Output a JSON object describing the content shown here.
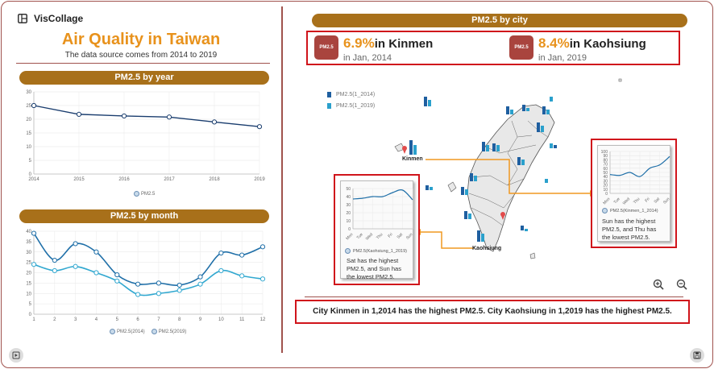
{
  "brand": {
    "name": "VisCollage"
  },
  "header": {
    "title": "Air Quality in Taiwan",
    "subtitle": "The data source comes from 2014 to 2019"
  },
  "year_panel": {
    "title": "PM2.5 by year"
  },
  "month_panel": {
    "title": "PM2.5 by month"
  },
  "city_panel": {
    "title": "PM2.5 by city"
  },
  "stats": [
    {
      "value": "6.9%",
      "text": "in Kinmen",
      "sub": "in Jan, 2014",
      "badge": "PM2.5"
    },
    {
      "value": "8.4%",
      "text": "in Kaohsiung",
      "sub": "in Jan, 2019",
      "badge": "PM2.5"
    }
  ],
  "map": {
    "legend": [
      "PM2.5(1_2014)",
      "PM2.5(1_2019)"
    ],
    "cities": {
      "kinmen": "Kinmen",
      "kaohsiung": "Kaohsiung"
    }
  },
  "popups": {
    "kaohsiung": {
      "legend": "PM2.5(Kaohsiung_1_2019)",
      "desc_lines": [
        "Sat has the highest",
        "PM2.5, and Sun has",
        "the lowest PM2.5."
      ]
    },
    "kinmen": {
      "legend": "PM2.5(Kinmen_1_2014)",
      "desc_lines": [
        "Sun has the highest",
        "PM2.5, and Thu has",
        "the lowest PM2.5."
      ]
    }
  },
  "summary": "City Kinmen in 1,2014 has the highest PM2.5. City Kaohsiung in 1,2019 has the highest PM2.5.",
  "colors": {
    "accent": "#e8921c",
    "pill": "#a8701a",
    "frame": "#a0524d",
    "highlight": "#d0141b",
    "series_dark": "#1f6fa8",
    "series_light": "#32a8d0",
    "year_line": "#1a3d6e"
  },
  "icons": {
    "brand": "layout-icon",
    "play": "play-icon",
    "save": "save-icon",
    "zoom_in": "zoom-in-icon",
    "zoom_out": "zoom-out-icon",
    "badge": "pm25-badge-icon"
  },
  "chart_data": [
    {
      "type": "line",
      "name": "year",
      "categories": [
        "2014",
        "2015",
        "2016",
        "2017",
        "2018",
        "2019"
      ],
      "series": [
        {
          "name": "PM2.5",
          "values": [
            25,
            21.8,
            21.2,
            20.8,
            19,
            17.3
          ]
        }
      ],
      "ylim": [
        0,
        30
      ],
      "yticks": [
        0,
        5,
        10,
        15,
        20,
        25,
        30
      ],
      "grid": true,
      "legend": "bottom"
    },
    {
      "type": "line",
      "name": "month",
      "categories": [
        "1",
        "2",
        "3",
        "4",
        "5",
        "6",
        "7",
        "8",
        "9",
        "10",
        "11",
        "12"
      ],
      "series": [
        {
          "name": "PM2.5(2014)",
          "values": [
            39,
            26,
            34,
            30,
            19,
            14.5,
            15,
            14,
            18,
            29.5,
            28.5,
            32.5
          ]
        },
        {
          "name": "PM2.5(2019)",
          "values": [
            24,
            21,
            23,
            20,
            16,
            9.5,
            10,
            11.5,
            14.5,
            21,
            18.5,
            17
          ]
        }
      ],
      "ylim": [
        0,
        40
      ],
      "yticks": [
        0,
        5,
        10,
        15,
        20,
        25,
        30,
        35,
        40
      ],
      "grid": true,
      "legend": "bottom"
    },
    {
      "type": "line",
      "name": "kaohsiung_week",
      "categories": [
        "Mon",
        "Tue",
        "Wed",
        "Thu",
        "Fri",
        "Sat",
        "Sun"
      ],
      "series": [
        {
          "name": "PM2.5(Kaohsiung_1_2019)",
          "values": [
            37,
            38,
            40,
            40,
            45,
            48,
            36
          ]
        }
      ],
      "ylim": [
        0,
        50
      ],
      "yticks": [
        0,
        10,
        20,
        30,
        40,
        50
      ],
      "grid": true,
      "legend": "bottom"
    },
    {
      "type": "line",
      "name": "kinmen_week",
      "categories": [
        "Mon",
        "Tue",
        "Wed",
        "Thu",
        "Fri",
        "Sat",
        "Sun"
      ],
      "series": [
        {
          "name": "PM2.5(Kinmen_1_2014)",
          "values": [
            45,
            43,
            50,
            40,
            60,
            68,
            88
          ]
        }
      ],
      "ylim": [
        0,
        100
      ],
      "yticks": [
        0,
        10,
        20,
        30,
        40,
        50,
        60,
        70,
        80,
        90,
        100
      ],
      "grid": true,
      "legend": "bottom"
    }
  ]
}
